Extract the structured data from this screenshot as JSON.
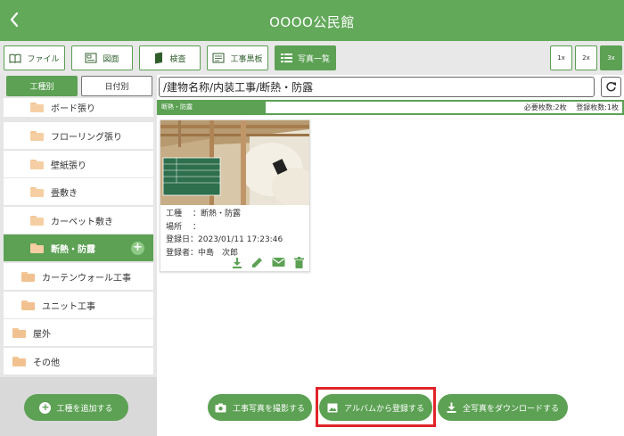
{
  "header": {
    "title": "OOOO公民館"
  },
  "toolbar": {
    "buttons": [
      {
        "label": "ファイル"
      },
      {
        "label": "図面"
      },
      {
        "label": "検査"
      },
      {
        "label": "工事黒板"
      },
      {
        "label": "写真一覧"
      }
    ],
    "zoom": [
      "1x",
      "2x",
      "3x"
    ],
    "active_button": "写真一覧",
    "active_zoom": "3x"
  },
  "left_panel": {
    "tabs": [
      {
        "label": "工種別"
      },
      {
        "label": "日付別"
      }
    ],
    "items": [
      {
        "label": "ボード張り"
      },
      {
        "label": "フローリング張り"
      },
      {
        "label": "壁紙張り"
      },
      {
        "label": "畳敷き"
      },
      {
        "label": "カーペット敷き"
      },
      {
        "label": "断熱・防露"
      },
      {
        "label": "カーテンウォール工事"
      },
      {
        "label": "ユニット工事"
      },
      {
        "label": "屋外"
      },
      {
        "label": "その他"
      }
    ],
    "selected_item": "断熱・防露",
    "add_button": "工種を追加する"
  },
  "main": {
    "path": "/建物名称/内装工事/断熱・防露",
    "category": "断熱・防露",
    "required": "必要枚数:2枚",
    "registered": "登録枚数:1枚",
    "card": {
      "rows": [
        {
          "label": "工種",
          "value": "：断熱・防露"
        },
        {
          "label": "場所",
          "value": "："
        },
        {
          "label": "登録日",
          "value": "：2023/01/11 17:23:46"
        },
        {
          "label": "登録者",
          "value": "：中島　次郎"
        }
      ]
    },
    "bottom_buttons": [
      {
        "label": "工事写真を撮影する"
      },
      {
        "label": "アルバムから登録する"
      },
      {
        "label": "全写真をダウンロードする"
      }
    ]
  },
  "colors": {
    "accent": "#5ca154",
    "highlight": "#e0242a"
  }
}
